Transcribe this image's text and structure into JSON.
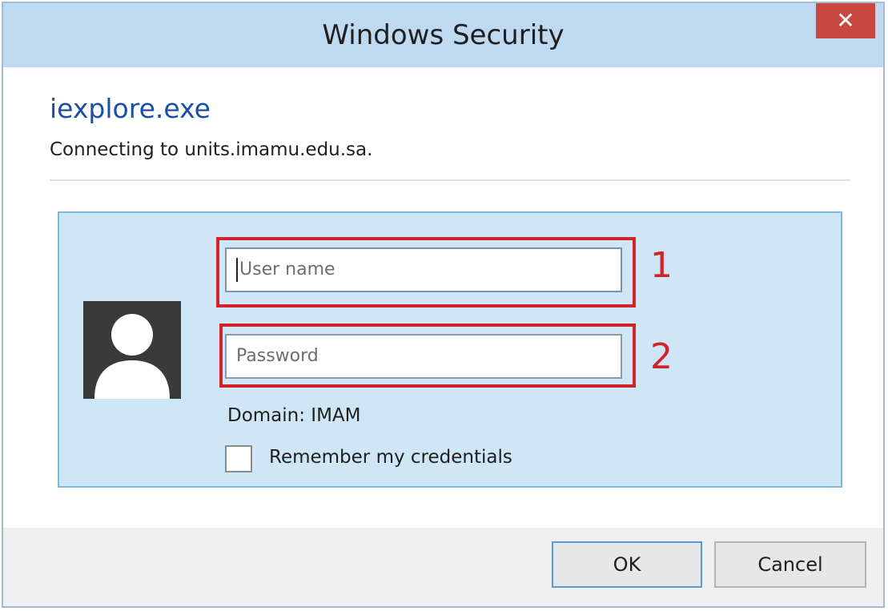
{
  "window": {
    "title": "Windows Security",
    "close_glyph": "✕"
  },
  "header": {
    "app_name": "iexplore.exe",
    "connecting_text": "Connecting to units.imamu.edu.sa."
  },
  "credentials": {
    "avatar_icon": "user-silhouette-icon",
    "username_placeholder": "User name",
    "password_placeholder": "Password",
    "annotation_1": "1",
    "annotation_2": "2",
    "domain_text": "Domain: IMAM",
    "remember_label": "Remember my credentials",
    "remember_checked": false
  },
  "footer": {
    "ok_label": "OK",
    "cancel_label": "Cancel"
  },
  "colors": {
    "titlebar": "#bfd9f0",
    "close_button": "#c8473f",
    "app_name": "#1b4fa5",
    "tile_background": "#cfe6f6",
    "annotation_red": "#d2232a"
  }
}
